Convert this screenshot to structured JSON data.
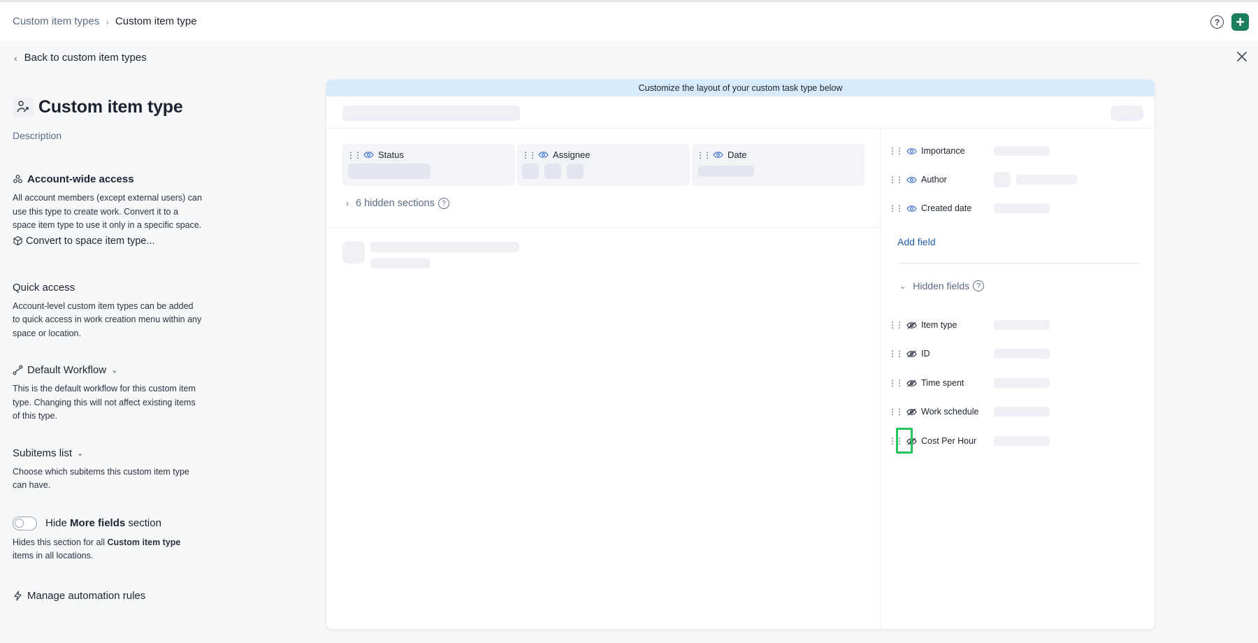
{
  "header": {
    "breadcrumb_root": "Custom item types",
    "breadcrumb_sep": "›",
    "breadcrumb_current": "Custom item type",
    "help_icon": "?",
    "add_icon": "+"
  },
  "back": {
    "label": "Back to custom item types"
  },
  "left": {
    "title": "Custom item type",
    "description": "Description",
    "account_access": {
      "heading": "Account-wide access",
      "text": "All account members (except external users) can use this type to create work. Convert it to a space item type to use it only in a specific space.",
      "convert_label": "Convert to space item type..."
    },
    "quick_access": {
      "heading": "Quick access",
      "text": "Account-level custom item types can be added to quick access in work creation menu within any space or location."
    },
    "workflow": {
      "heading": "Default Workflow",
      "text": "This is the default workflow for this custom item type. Changing this will not affect existing items of this type."
    },
    "subitems": {
      "heading": "Subitems list",
      "text": "Choose which subitems this custom item type can have."
    },
    "hide_more": {
      "prefix": "Hide",
      "bold": "More fields",
      "suffix": "section",
      "text_prefix": "Hides this section for all",
      "text_bold": "Custom item type",
      "text_suffix": "items in all locations.",
      "enabled": false
    },
    "automation": {
      "label": "Manage automation rules"
    }
  },
  "canvas": {
    "banner": "Customize the layout of your custom task type below",
    "columns": [
      {
        "label": "Status"
      },
      {
        "label": "Assignee"
      },
      {
        "label": "Date"
      }
    ],
    "hidden_sections": "6 hidden sections",
    "visible_fields": [
      {
        "label": "Importance"
      },
      {
        "label": "Author"
      },
      {
        "label": "Created date"
      }
    ],
    "add_field": "Add field",
    "hidden_fields_label": "Hidden fields",
    "hidden_fields": [
      {
        "label": "Item type"
      },
      {
        "label": "ID"
      },
      {
        "label": "Time spent"
      },
      {
        "label": "Work schedule"
      },
      {
        "label": "Cost Per Hour"
      }
    ]
  },
  "colors": {
    "accent_green": "#1a7f5a",
    "link_blue": "#1e5ea8",
    "banner": "#d8ebfb",
    "highlight": "#22c55e"
  }
}
